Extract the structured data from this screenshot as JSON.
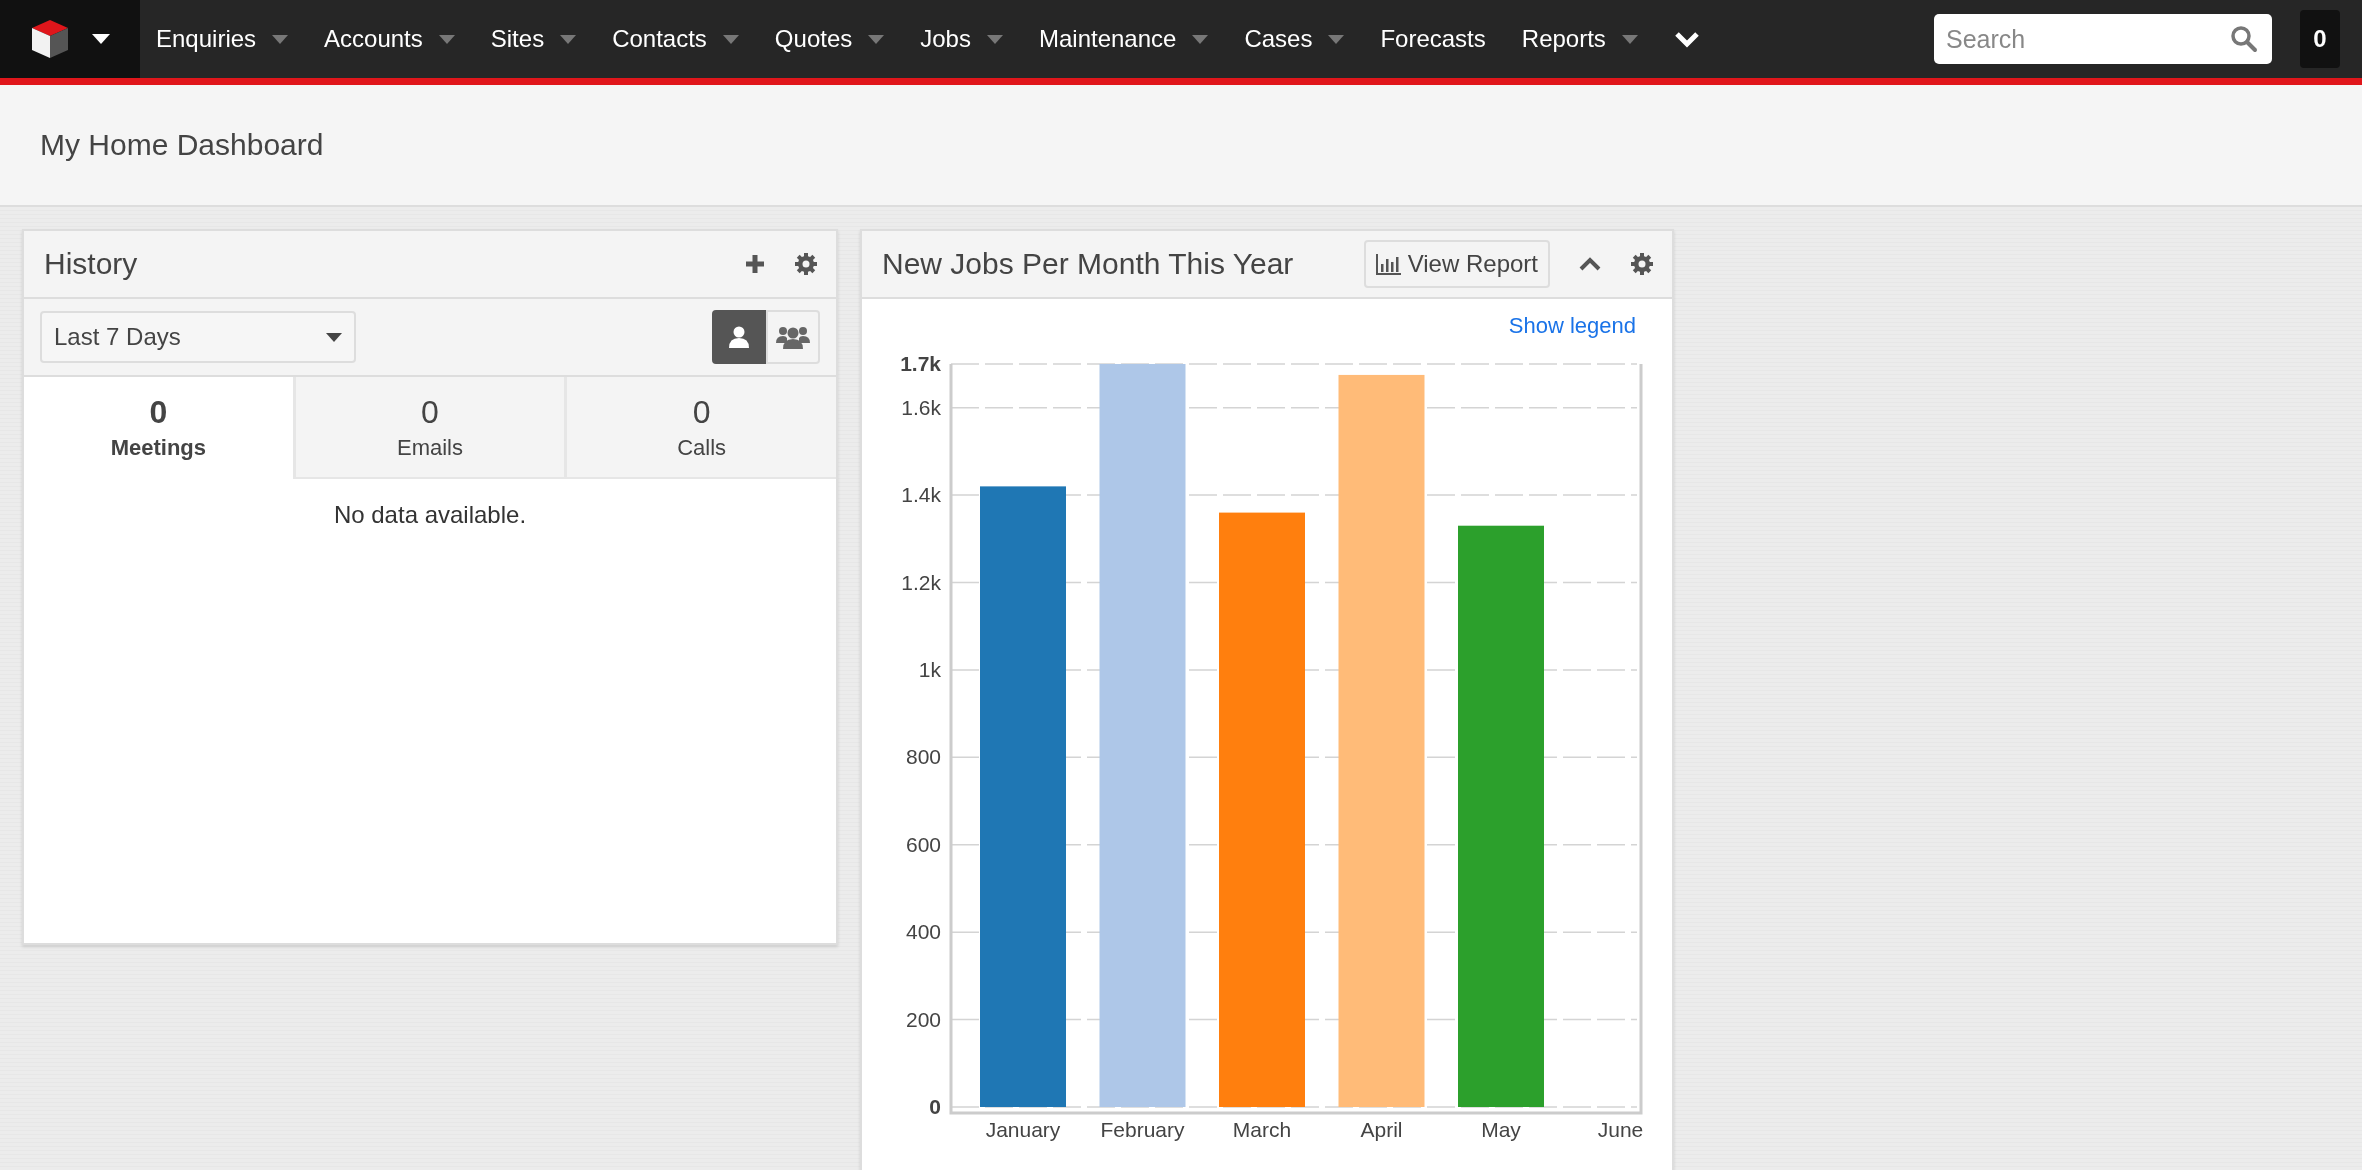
{
  "nav": {
    "items": [
      {
        "label": "Enquiries",
        "has_menu": true
      },
      {
        "label": "Accounts",
        "has_menu": true
      },
      {
        "label": "Sites",
        "has_menu": true
      },
      {
        "label": "Contacts",
        "has_menu": true
      },
      {
        "label": "Quotes",
        "has_menu": true
      },
      {
        "label": "Jobs",
        "has_menu": true
      },
      {
        "label": "Maintenance",
        "has_menu": true
      },
      {
        "label": "Cases",
        "has_menu": true
      },
      {
        "label": "Forecasts",
        "has_menu": false
      },
      {
        "label": "Reports",
        "has_menu": true
      }
    ],
    "search": {
      "placeholder": "Search"
    },
    "badge": "0"
  },
  "page_title": "My Home Dashboard",
  "history": {
    "title": "History",
    "range": "Last 7 Days",
    "views": [
      {
        "kind": "user",
        "selected": true
      },
      {
        "kind": "group",
        "selected": false
      }
    ],
    "tabs": [
      {
        "count": "0",
        "label": "Meetings",
        "selected": true
      },
      {
        "count": "0",
        "label": "Emails",
        "selected": false
      },
      {
        "count": "0",
        "label": "Calls",
        "selected": false
      }
    ],
    "empty": "No data available."
  },
  "chart_panel": {
    "title": "New Jobs Per Month This Year",
    "view_report": "View Report",
    "legend_link": "Show legend",
    "chart_data": {
      "type": "bar",
      "categories": [
        "January",
        "February",
        "March",
        "April",
        "May",
        "June"
      ],
      "values": [
        1420,
        1700,
        1360,
        1675,
        1330,
        null
      ],
      "colors": [
        "#1f77b4",
        "#aec7e8",
        "#ff7f0e",
        "#ffbb78",
        "#2ca02c",
        null
      ],
      "grid": true,
      "ylim": [
        0,
        1700
      ],
      "yticks": [
        0,
        200,
        400,
        600,
        800,
        {
          "value": 1000,
          "label": "1k"
        },
        {
          "value": 1200,
          "label": "1.2k"
        },
        {
          "value": 1400,
          "label": "1.4k"
        },
        {
          "value": 1600,
          "label": "1.6k"
        },
        {
          "value": 1700,
          "label": "1.7k"
        }
      ]
    }
  }
}
